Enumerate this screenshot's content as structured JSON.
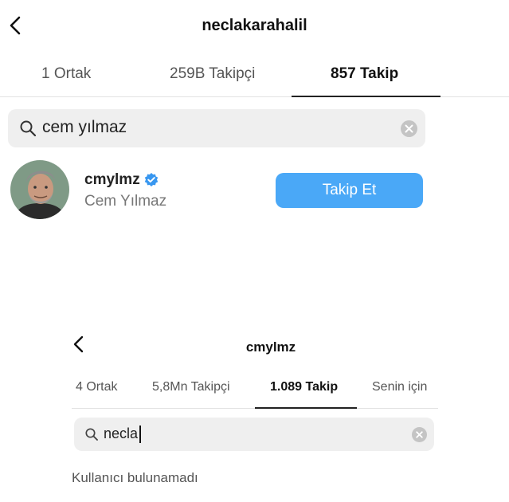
{
  "top_profile": {
    "username": "neclakarahalil",
    "tabs": [
      {
        "label": "1 Ortak"
      },
      {
        "label": "259B Takipçi"
      },
      {
        "label": "857 Takip"
      }
    ],
    "search": {
      "query": "cem yılmaz"
    },
    "result": {
      "username": "cmylmz",
      "full_name": "Cem Yılmaz",
      "verified": true,
      "follow_label": "Takip Et"
    }
  },
  "bottom_profile": {
    "username": "cmylmz",
    "tabs": [
      {
        "label": "4 Ortak"
      },
      {
        "label": "5,8Mn Takipçi"
      },
      {
        "label": "1.089 Takip"
      },
      {
        "label": "Senin için"
      }
    ],
    "search": {
      "query": "necla"
    },
    "empty_message": "Kullanıcı bulunamadı"
  },
  "colors": {
    "follow_button": "#4aa8f7",
    "verified_badge": "#3897f0",
    "search_bg": "#efefef"
  },
  "icons": [
    "back-arrow-icon",
    "search-icon",
    "clear-icon",
    "verified-badge-icon",
    "avatar"
  ]
}
